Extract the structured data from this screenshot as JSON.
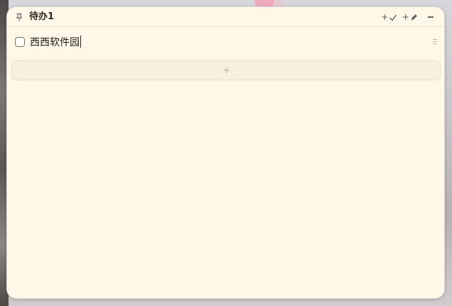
{
  "window": {
    "title": "待办1"
  },
  "titlebar": {
    "pin_icon": "pin-icon",
    "add_todo_label": "+",
    "add_todo_icon": "check-icon",
    "add_note_label": "+",
    "add_note_icon": "pencil-icon",
    "minimize_icon": "minimize-icon"
  },
  "todos": [
    {
      "text": "西西软件园",
      "checked": false
    }
  ],
  "add_row": {
    "label": "+"
  },
  "colors": {
    "background": "#fff8e8",
    "checkbox_border": "#77745f",
    "add_row_background": "#f8efdf",
    "title_text": "#2d2924"
  }
}
